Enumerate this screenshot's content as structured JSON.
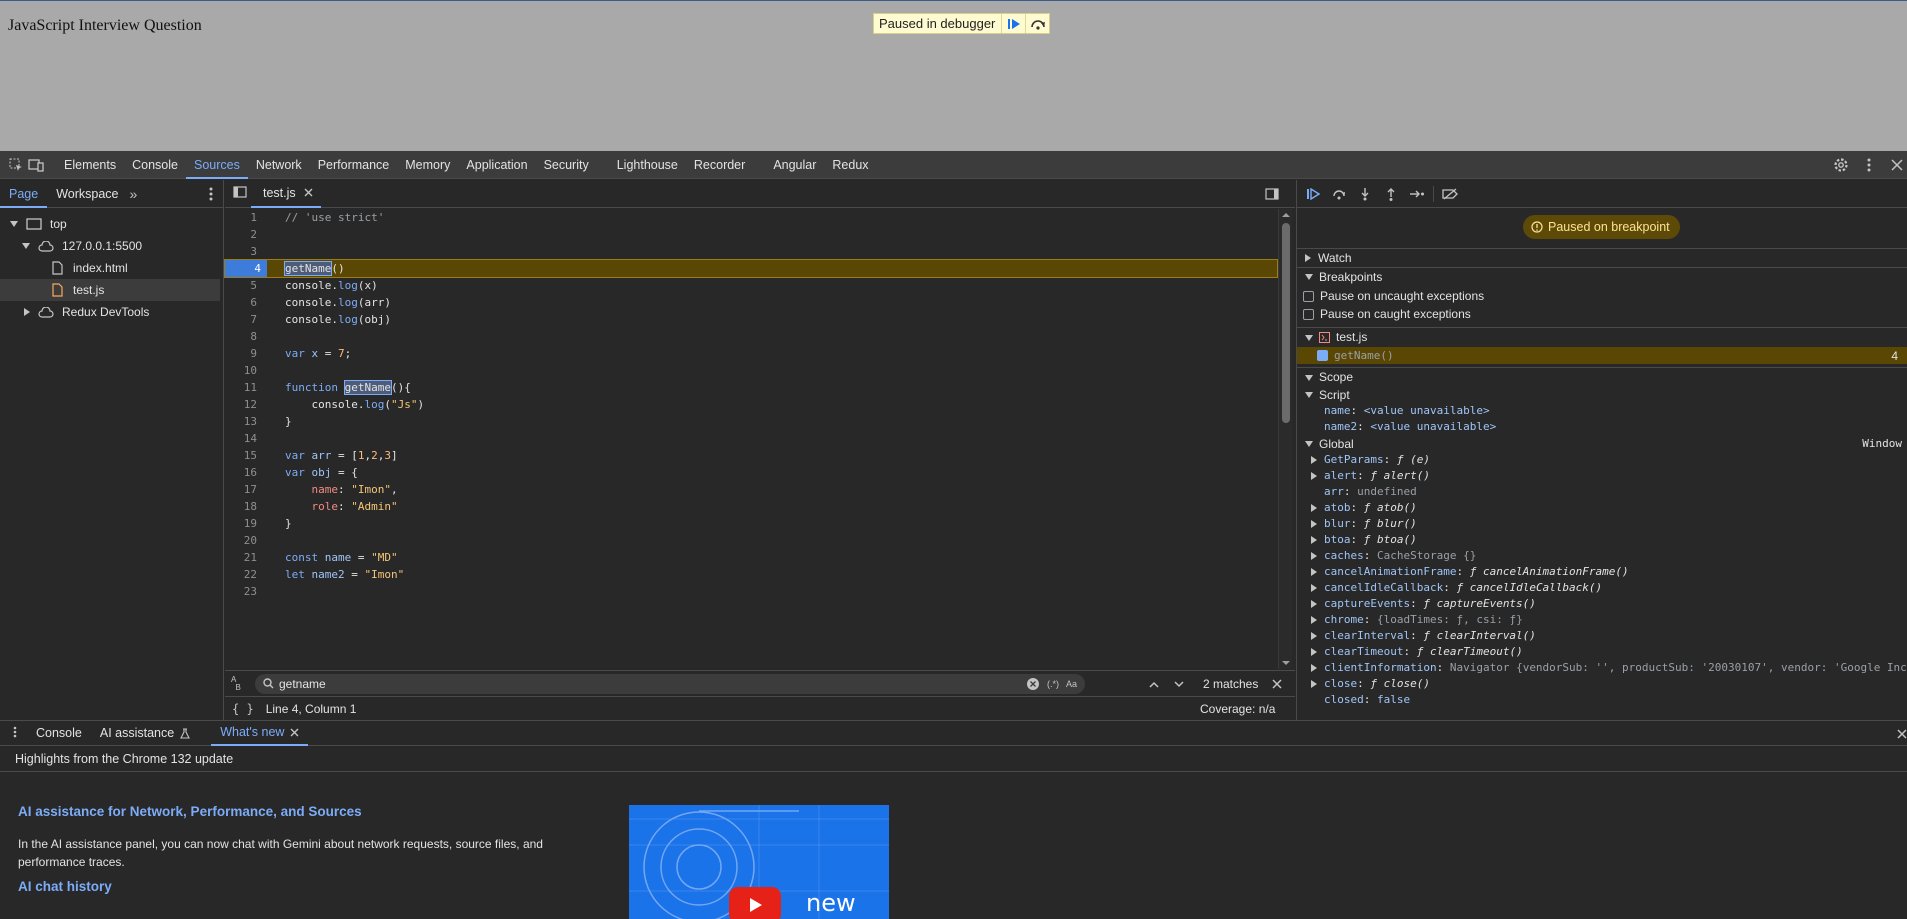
{
  "page": {
    "heading": "JavaScript Interview Question",
    "paused_text": "Paused in debugger"
  },
  "toolbar": {
    "tabs": [
      "Elements",
      "Console",
      "Sources",
      "Network",
      "Performance",
      "Memory",
      "Application",
      "Security",
      "Lighthouse",
      "Recorder",
      "Angular",
      "Redux"
    ],
    "active_tab": "Sources"
  },
  "navigator": {
    "tabs": [
      "Page",
      "Workspace"
    ],
    "tree": {
      "top": "top",
      "host": "127.0.0.1:5500",
      "file1": "index.html",
      "file2": "test.js",
      "ext": "Redux DevTools"
    }
  },
  "editor": {
    "file_tab": "test.js",
    "exec_line": 4,
    "lines": [
      "// 'use strict'",
      "",
      "",
      "getName()",
      "console.log(x)",
      "console.log(arr)",
      "console.log(obj)",
      "",
      "var x = 7;",
      "",
      "function getName(){",
      "    console.log(\"Js\")",
      "}",
      "",
      "var arr = [1,2,3]",
      "var obj = {",
      "    name: \"Imon\",",
      "    role: \"Admin\"",
      "}",
      "",
      "const name = \"MD\"",
      "let name2 = \"Imon\"",
      ""
    ],
    "search": {
      "value": "getname",
      "matches": "2 matches"
    },
    "status": {
      "position": "Line 4, Column 1",
      "coverage": "Coverage: n/a"
    }
  },
  "debugger": {
    "banner": "Paused on breakpoint",
    "watch_label": "Watch",
    "breakpoints_label": "Breakpoints",
    "pause_uncaught": "Pause on uncaught exceptions",
    "pause_caught": "Pause on caught exceptions",
    "bp_file": "test.js",
    "bp_code": "getName()",
    "bp_line": "4",
    "scope_label": "Scope",
    "script_label": "Script",
    "script_vars": [
      {
        "name": "name",
        "value": "<value unavailable>"
      },
      {
        "name": "name2",
        "value": "<value unavailable>"
      }
    ],
    "global_label": "Global",
    "global_value": "Window",
    "global_vars": [
      {
        "name": "GetParams",
        "value": "ƒ (e)",
        "exp": true,
        "kind": "fn"
      },
      {
        "name": "alert",
        "value": "ƒ alert()",
        "exp": true,
        "kind": "fn"
      },
      {
        "name": "arr",
        "value": "undefined",
        "exp": false,
        "kind": "gray"
      },
      {
        "name": "atob",
        "value": "ƒ atob()",
        "exp": true,
        "kind": "fn"
      },
      {
        "name": "blur",
        "value": "ƒ blur()",
        "exp": true,
        "kind": "fn"
      },
      {
        "name": "btoa",
        "value": "ƒ btoa()",
        "exp": true,
        "kind": "fn"
      },
      {
        "name": "caches",
        "value": "CacheStorage {}",
        "exp": true,
        "kind": "obj"
      },
      {
        "name": "cancelAnimationFrame",
        "value": "ƒ cancelAnimationFrame()",
        "exp": true,
        "kind": "fn"
      },
      {
        "name": "cancelIdleCallback",
        "value": "ƒ cancelIdleCallback()",
        "exp": true,
        "kind": "fn"
      },
      {
        "name": "captureEvents",
        "value": "ƒ captureEvents()",
        "exp": true,
        "kind": "fn"
      },
      {
        "name": "chrome",
        "value": "{loadTimes: ƒ, csi: ƒ}",
        "exp": true,
        "kind": "obj"
      },
      {
        "name": "clearInterval",
        "value": "ƒ clearInterval()",
        "exp": true,
        "kind": "fn"
      },
      {
        "name": "clearTimeout",
        "value": "ƒ clearTimeout()",
        "exp": true,
        "kind": "fn"
      },
      {
        "name": "clientInformation",
        "value": "Navigator {vendorSub: '', productSub: '20030107', vendor: 'Google Inc",
        "exp": true,
        "kind": "obj"
      },
      {
        "name": "close",
        "value": "ƒ close()",
        "exp": true,
        "kind": "fn"
      },
      {
        "name": "closed",
        "value": "false",
        "exp": false,
        "kind": "bool"
      }
    ]
  },
  "drawer": {
    "tabs": [
      "Console",
      "AI assistance",
      "What's new"
    ],
    "header": "Highlights from the Chrome 132 update",
    "title": "AI assistance for Network, Performance, and Sources",
    "body": "In the AI assistance panel, you can now chat with Gemini about network requests, source files, and performance traces.",
    "subtitle": "AI chat history",
    "video_label": "new"
  },
  "colors": {
    "accent": "#7cacf8",
    "panel_bg": "#282828",
    "exec_line": "#5a4704"
  }
}
